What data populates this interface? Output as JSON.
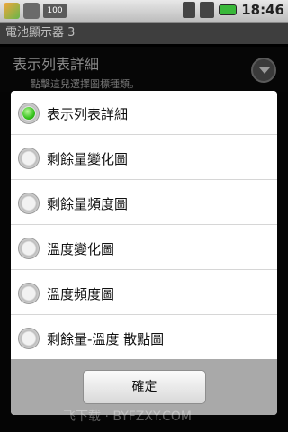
{
  "status_bar": {
    "time": "18:46",
    "battery_app_icon_text": "100",
    "icons": [
      "app-icon",
      "android-icon",
      "battery-level-icon",
      "wifi-icon",
      "signal-icon",
      "battery-icon"
    ]
  },
  "app": {
    "title": "電池顯示器 3",
    "preference": {
      "title": "表示列表詳細",
      "summary": "點擊這兒選擇圖標種類。"
    }
  },
  "dialog": {
    "options": [
      {
        "label": "表示列表詳細",
        "checked": true
      },
      {
        "label": "剩餘量變化圖",
        "checked": false
      },
      {
        "label": "剩餘量頻度圖",
        "checked": false
      },
      {
        "label": "溫度變化圖",
        "checked": false
      },
      {
        "label": "溫度頻度圖",
        "checked": false
      },
      {
        "label": "剩餘量-溫度 散點圖",
        "checked": false
      }
    ],
    "ok_label": "確定"
  },
  "watermark": "飞下载 · BYFZXY.COM"
}
